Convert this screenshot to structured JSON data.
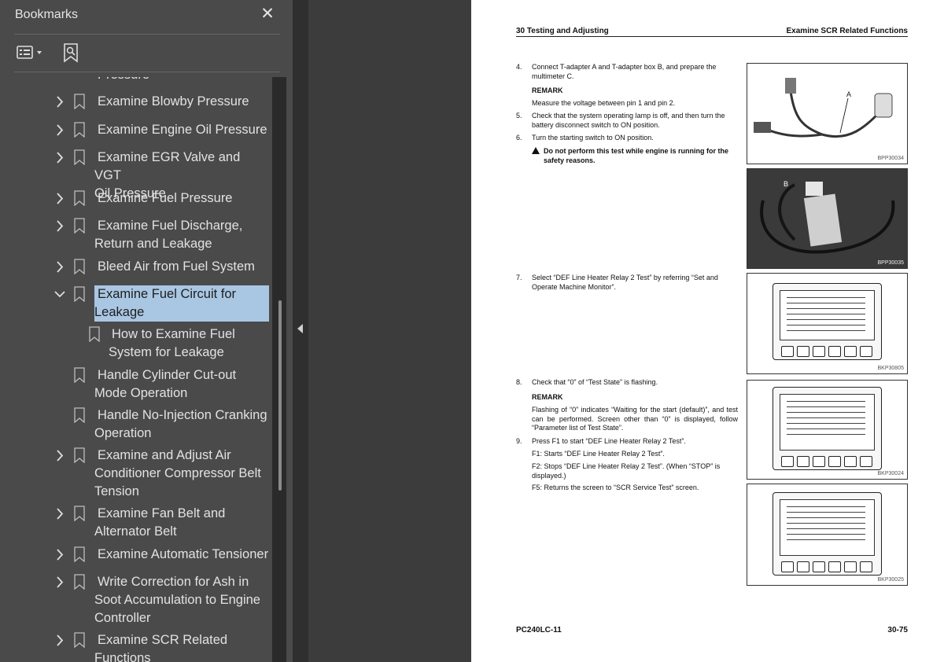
{
  "sidebar": {
    "title": "Bookmarks",
    "close_glyph": "✕",
    "options_icon": "list-options-icon",
    "bookmark_search_icon": "bookmark-search-icon",
    "items": [
      {
        "label": "Pressure",
        "expandable": false,
        "partial": true
      },
      {
        "label": "Examine Blowby Pressure",
        "expandable": true
      },
      {
        "label": "Examine Engine Oil Pressure",
        "expandable": true
      },
      {
        "label": "Examine EGR Valve and VGT Oil Pressure",
        "line1": "Examine EGR Valve and VGT",
        "line2": "Oil Pressure",
        "expandable": true
      },
      {
        "label": "Examine Fuel Pressure",
        "expandable": true
      },
      {
        "label": "Examine Fuel Discharge, Return and Leakage",
        "line1": "Examine Fuel Discharge,",
        "line2": "Return and Leakage",
        "expandable": true
      },
      {
        "label": "Bleed Air from Fuel System",
        "expandable": true
      },
      {
        "label": "Examine Fuel Circuit for Leakage",
        "line1": "Examine Fuel Circuit for",
        "line2": "Leakage",
        "expandable": true,
        "expanded": true,
        "selected": true
      },
      {
        "label": "How to Examine Fuel System for Leakage",
        "line1": "How to Examine Fuel",
        "line2": "System for Leakage",
        "child": true
      },
      {
        "label": "Handle Cylinder Cut-out Mode Operation",
        "line1": "Handle Cylinder Cut-out",
        "line2": "Mode Operation",
        "expandable": false
      },
      {
        "label": "Handle No-Injection Cranking Operation",
        "line1": "Handle No-Injection Cranking",
        "line2": "Operation",
        "expandable": false
      },
      {
        "label": "Examine and Adjust Air Conditioner Compressor Belt Tension",
        "line1": "Examine and Adjust Air",
        "line2": "Conditioner Compressor Belt",
        "line3": "Tension",
        "expandable": true
      },
      {
        "label": "Examine Fan Belt and Alternator Belt",
        "line1": "Examine Fan Belt and",
        "line2": "Alternator Belt",
        "expandable": true
      },
      {
        "label": "Examine Automatic Tensioner",
        "expandable": true
      },
      {
        "label": "Write Correction for Ash in Soot Accumulation to Engine Controller",
        "line1": "Write Correction for Ash in",
        "line2": "Soot Accumulation to Engine",
        "line3": "Controller",
        "expandable": true
      },
      {
        "label": "Examine SCR Related Functions",
        "line1": "Examine SCR Related",
        "line2": "Functions",
        "expandable": true
      }
    ]
  },
  "document": {
    "header_left": "30 Testing and Adjusting",
    "header_right": "Examine SCR Related Functions",
    "footer_left": "PC240LC-11",
    "footer_right": "30-75",
    "steps": {
      "s4_num": "4.",
      "s4": "Connect T-adapter A and T-adapter box B, and prepare the multimeter C.",
      "remark": "REMARK",
      "remark_text": "Measure the voltage between pin 1 and pin 2.",
      "s5_num": "5.",
      "s5": "Check that the system operating lamp is off, and then turn the battery disconnect switch to ON position.",
      "s6_num": "6.",
      "s6": "Turn the starting switch to ON position.",
      "warning": "Do not perform this test while engine is running for the safety reasons.",
      "s7_num": "7.",
      "s7": "Select “DEF Line Heater Relay 2 Test” by referring “Set and Operate Machine Monitor”.",
      "s8_num": "8.",
      "s8": "Check that “0” of “Test State” is flashing.",
      "remark2": "REMARK",
      "remark2_text": "Flashing of “0” indicates “Waiting for the start (default)”, and test can be performed. Screen other than “0” is displayed, follow “Parameter list of Test State”.",
      "s9_num": "9.",
      "s9": "Press F1 to start “DEF Line Heater Relay 2 Test”.",
      "f1": "F1: Starts “DEF Line Heater Relay 2 Test”.",
      "f2": "F2: Stops “DEF Line Heater Relay 2 Test”. (When “STOP” is displayed.)",
      "f5": "F5: Returns the screen to “SCR Service Test” screen."
    },
    "figures": {
      "fig1_id": "BPP30034",
      "fig1_label": "A",
      "fig2_id": "BPP30035",
      "fig2_label": "B",
      "fig3_id": "BKP30805",
      "fig4_id": "BKP30024",
      "fig5_id": "BKP30025"
    }
  }
}
